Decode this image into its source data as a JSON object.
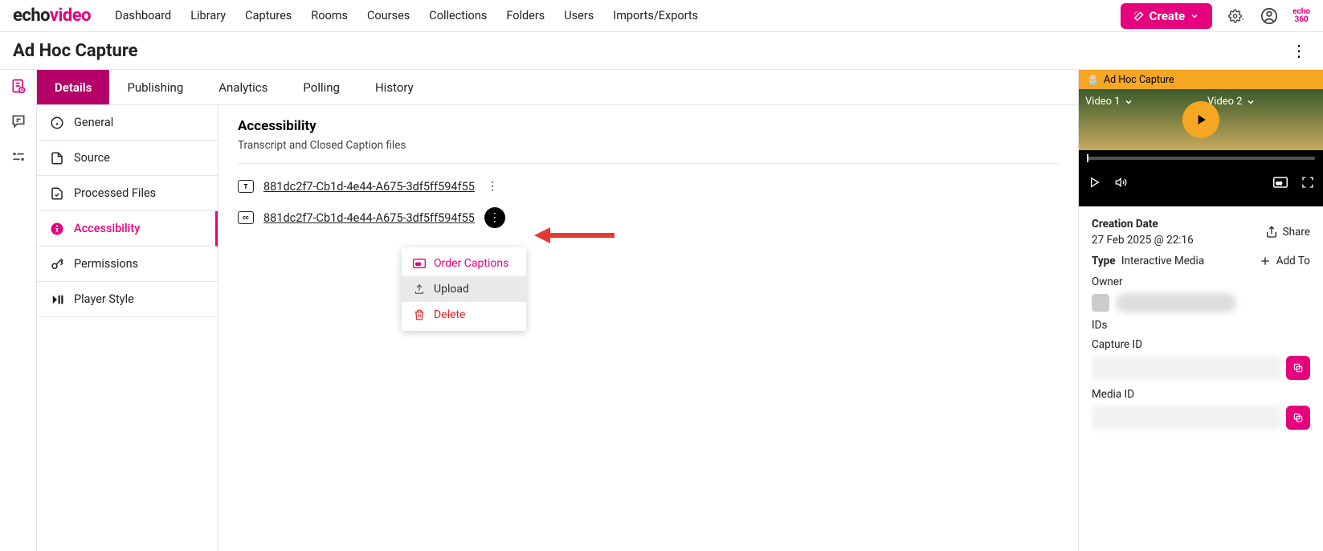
{
  "logo": {
    "part1": "echo",
    "part2": "video"
  },
  "nav": {
    "items": [
      "Dashboard",
      "Library",
      "Captures",
      "Rooms",
      "Courses",
      "Collections",
      "Folders",
      "Users",
      "Imports/Exports"
    ]
  },
  "create_label": "Create",
  "echo360": "echo 360",
  "page_title": "Ad Hoc Capture",
  "tabs": [
    "Details",
    "Publishing",
    "Analytics",
    "Polling",
    "History"
  ],
  "subnav": {
    "items": [
      {
        "label": "General"
      },
      {
        "label": "Source"
      },
      {
        "label": "Processed Files"
      },
      {
        "label": "Accessibility"
      },
      {
        "label": "Permissions"
      },
      {
        "label": "Player Style"
      }
    ]
  },
  "content": {
    "heading": "Accessibility",
    "sub": "Transcript and Closed Caption files",
    "files": [
      {
        "icon": "T",
        "name": "881dc2f7-Cb1d-4e44-A675-3df5ff594f55"
      },
      {
        "icon": "cc",
        "name": "881dc2f7-Cb1d-4e44-A675-3df5ff594f55"
      }
    ]
  },
  "ctxmenu": {
    "order": "Order Captions",
    "upload": "Upload",
    "delete": "Delete"
  },
  "preview": {
    "title": "Ad Hoc Capture",
    "video1": "Video 1",
    "video2": "Video 2",
    "creation_label": "Creation Date",
    "creation_value": "27 Feb 2025 @ 22:16",
    "share": "Share",
    "type_label": "Type",
    "type_value": "Interactive Media",
    "addto": "Add To",
    "owner_label": "Owner",
    "ids_label": "IDs",
    "capture_id_label": "Capture ID",
    "media_id_label": "Media ID"
  }
}
